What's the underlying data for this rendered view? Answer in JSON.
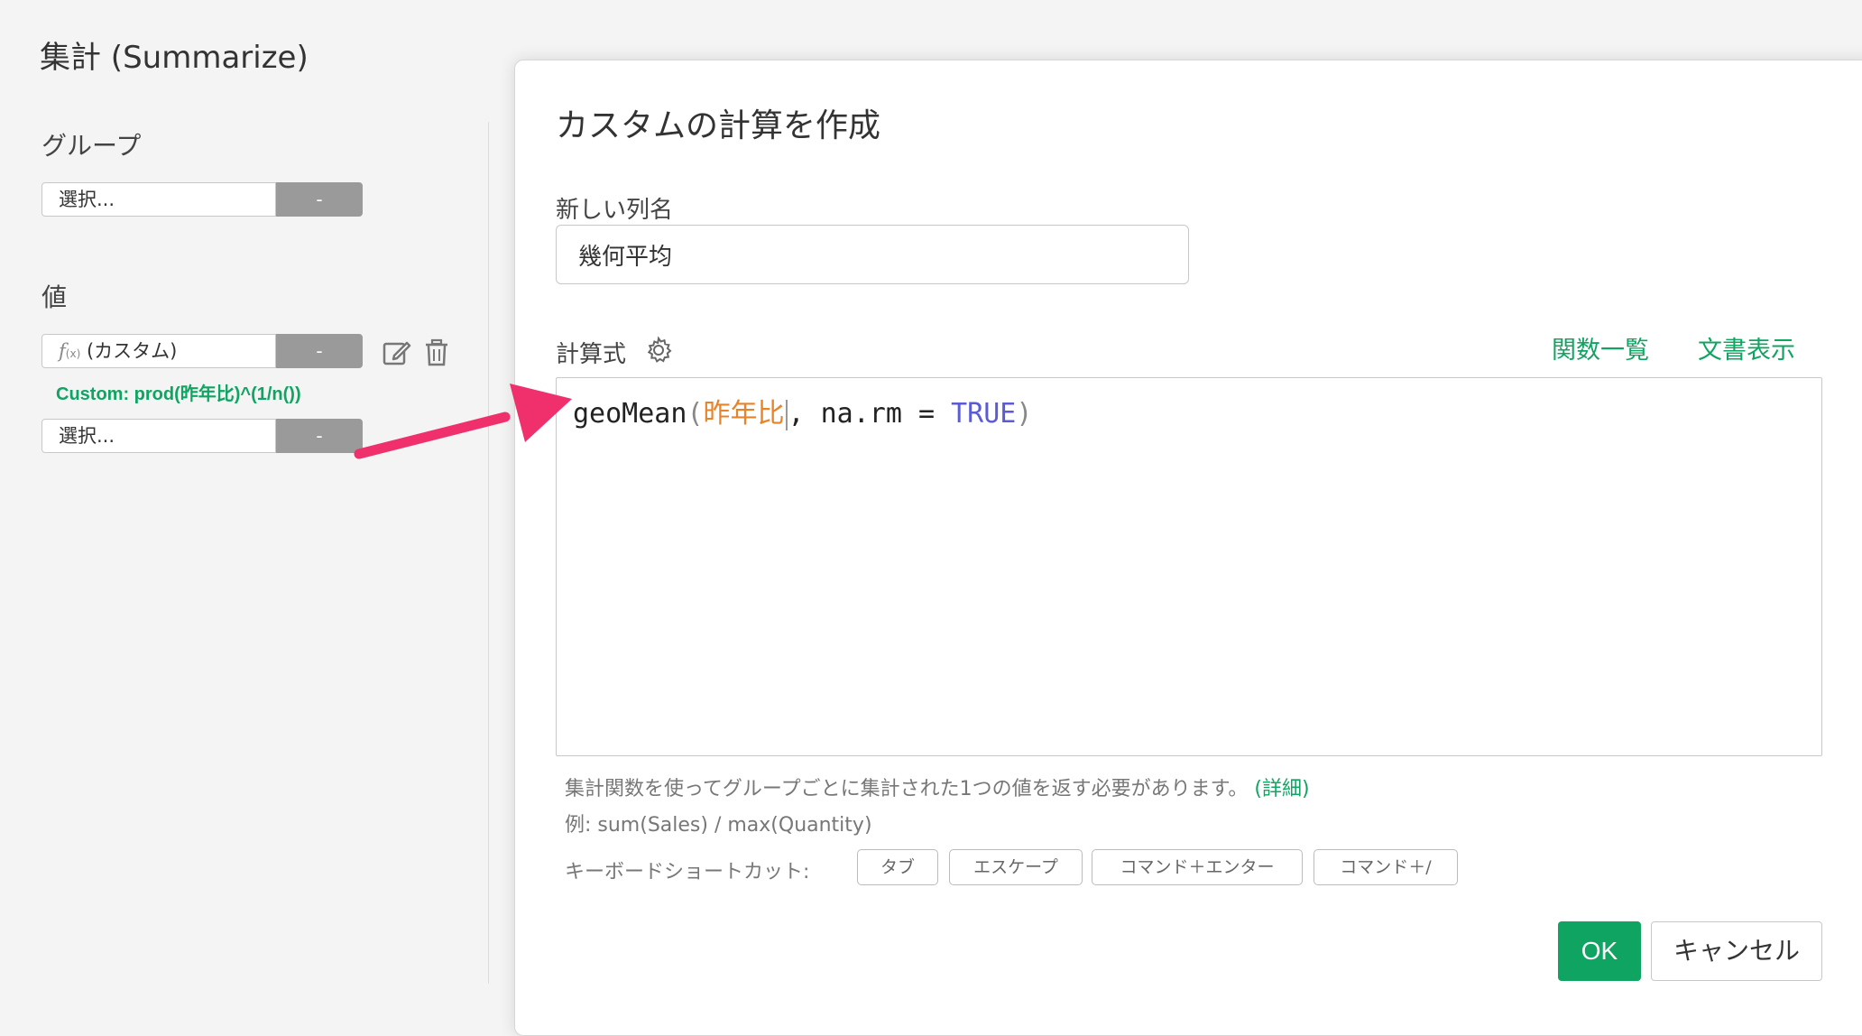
{
  "left_panel": {
    "title": "集計 (Summarize)",
    "group_label": "グループ",
    "group_select_placeholder": "選択...",
    "remove_symbol": "-",
    "value_label": "値",
    "custom_value_fx": "f",
    "custom_value_fx_sub": "(x)",
    "custom_value_text": "(カスタム)",
    "custom_caption": "Custom: prod(昨年比)^(1/n())",
    "value_select_placeholder": "選択..."
  },
  "dialog": {
    "title": "カスタムの計算を作成",
    "new_column_label": "新しい列名",
    "new_column_value": "幾何平均",
    "expression_label": "計算式",
    "functions_link": "関数一覧",
    "docs_link": "文書表示",
    "code": {
      "func": "geoMean",
      "open_paren": "(",
      "column": "昨年比",
      "rest": ", na.rm = ",
      "keyword": "TRUE",
      "close_paren": ")"
    },
    "help_text": "集計関数を使ってグループごとに集計された1つの値を返す必要があります。",
    "help_link": "(詳細)",
    "example_text": "例: sum(Sales) / max(Quantity)",
    "shortcuts_label": "キーボードショートカット:",
    "shortcuts": [
      "タブ",
      "エスケープ",
      "コマンド＋エンター",
      "コマンド＋/"
    ],
    "ok_label": "OK",
    "cancel_label": "キャンセル"
  },
  "colors": {
    "accent_green": "#10a462",
    "arrow_pink": "#f0306c",
    "column_orange": "#e8832a",
    "keyword_blue": "#5b5bd6"
  }
}
